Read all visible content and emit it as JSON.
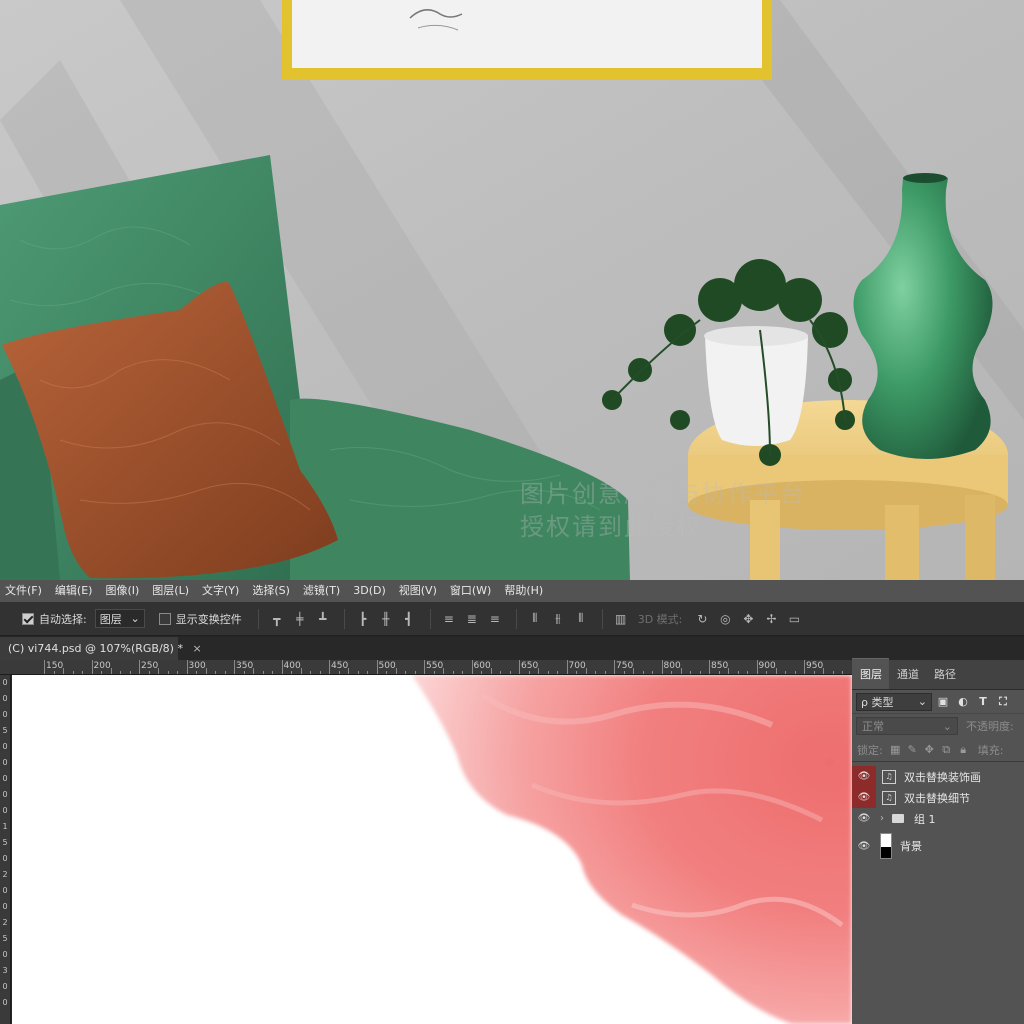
{
  "scene": {
    "watermark_line1": "图片创意服务与协作平台",
    "watermark_line2": "授权请到此授权"
  },
  "menu": {
    "items": [
      "文件(F)",
      "编辑(E)",
      "图像(I)",
      "图层(L)",
      "文字(Y)",
      "选择(S)",
      "滤镜(T)",
      "3D(D)",
      "视图(V)",
      "窗口(W)",
      "帮助(H)"
    ]
  },
  "options": {
    "auto_select_label": "自动选择:",
    "auto_select_checked": true,
    "target_value": "图层",
    "show_transform_label": "显示变换控件",
    "show_transform_checked": false,
    "mode_3d_label": "3D 模式:"
  },
  "document": {
    "tab_title": "(C) vi744.psd @ 107%(RGB/8) *",
    "close_glyph": "×"
  },
  "ruler": {
    "top_labels": [
      "150",
      "200",
      "250",
      "300",
      "350",
      "400",
      "450",
      "500",
      "550",
      "600",
      "650",
      "700",
      "750",
      "800",
      "850",
      "900",
      "950"
    ],
    "left_labels": [
      "0",
      "0",
      "0",
      "5",
      "0",
      "0",
      "0",
      "0",
      "0",
      "1",
      "5",
      "0",
      "2",
      "0",
      "0",
      "2",
      "5",
      "0",
      "3",
      "0",
      "0"
    ]
  },
  "layers_panel": {
    "tabs": [
      "图层",
      "通道",
      "路径"
    ],
    "active_tab": "图层",
    "filter_value": "类型",
    "filter_prefix": "ρ",
    "blend_mode": "正常",
    "opacity_label": "不透明度:",
    "lock_label": "锁定:",
    "fill_label": "填充:",
    "layers": [
      {
        "name": "双击替换装饰画",
        "type": "smart",
        "visible": true,
        "highlighted": true
      },
      {
        "name": "双击替换细节",
        "type": "smart",
        "visible": true,
        "highlighted": true
      },
      {
        "name": "组 1",
        "type": "group",
        "visible": true,
        "highlighted": false
      },
      {
        "name": "背景",
        "type": "background",
        "visible": true,
        "highlighted": false
      }
    ]
  },
  "colors": {
    "menu_bg": "#535353",
    "panel_bg": "#535353",
    "workspace_bg": "#282828",
    "layer_highlight": "#8d2b2b",
    "watercolor": "#f08282"
  }
}
